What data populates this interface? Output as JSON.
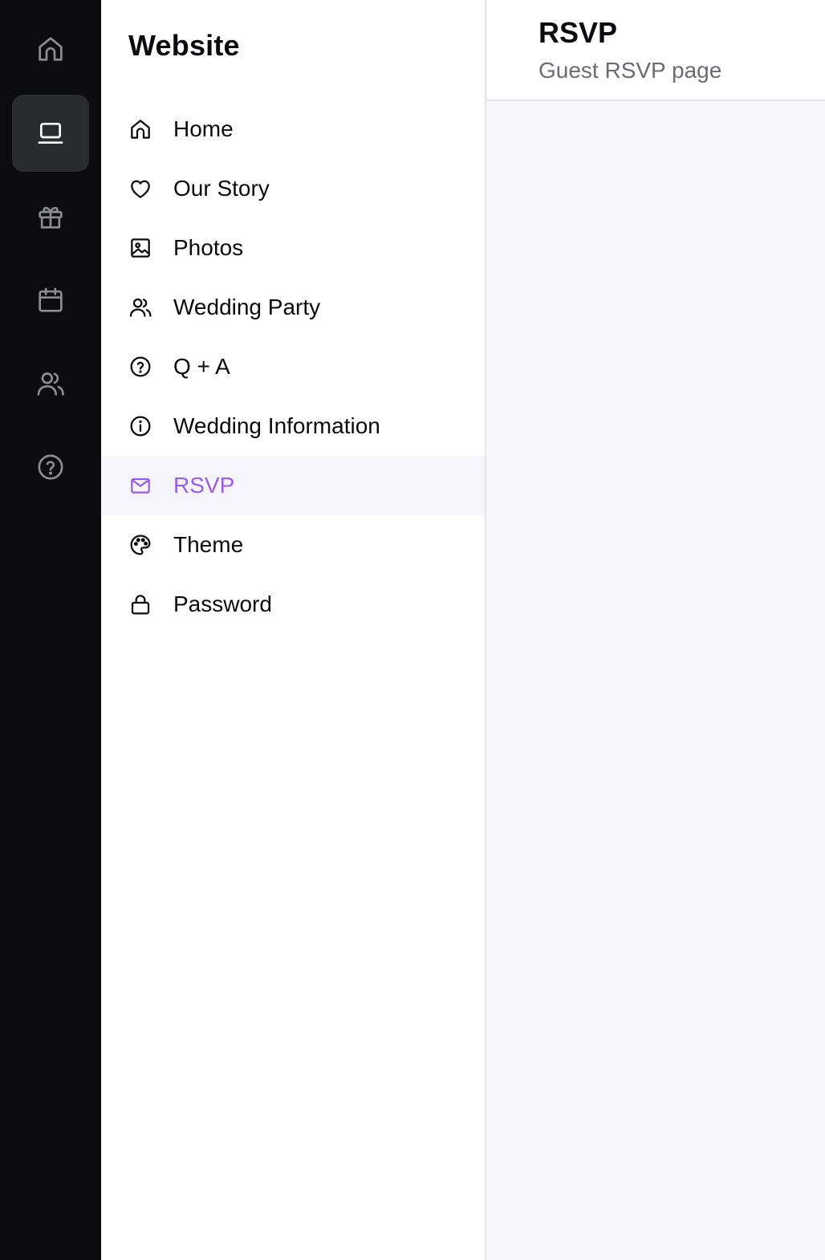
{
  "rail": {
    "items": [
      {
        "icon": "home-icon",
        "active": false
      },
      {
        "icon": "laptop-icon",
        "active": true
      },
      {
        "icon": "gift-icon",
        "active": false
      },
      {
        "icon": "calendar-icon",
        "active": false
      },
      {
        "icon": "users-icon",
        "active": false
      },
      {
        "icon": "help-circle-icon",
        "active": false
      }
    ]
  },
  "sidebar": {
    "title": "Website",
    "items": [
      {
        "label": "Home",
        "icon": "home-icon"
      },
      {
        "label": "Our Story",
        "icon": "heart-icon"
      },
      {
        "label": "Photos",
        "icon": "image-icon"
      },
      {
        "label": "Wedding Party",
        "icon": "users-icon"
      },
      {
        "label": "Q + A",
        "icon": "help-circle-icon"
      },
      {
        "label": "Wedding Information",
        "icon": "info-icon"
      },
      {
        "label": "RSVP",
        "icon": "mail-icon",
        "active": true
      },
      {
        "label": "Theme",
        "icon": "palette-icon"
      },
      {
        "label": "Password",
        "icon": "lock-icon"
      }
    ]
  },
  "header": {
    "title": "RSVP",
    "subtitle": "Guest RSVP page"
  },
  "colors": {
    "rail_bg": "#0c0b12",
    "rail_active_bg": "#2a2a31",
    "rail_icon": "#8d8d96",
    "accent": "#9b5de5",
    "active_row_bg": "#f6f5fd",
    "content_bg": "#f7f7fc"
  }
}
